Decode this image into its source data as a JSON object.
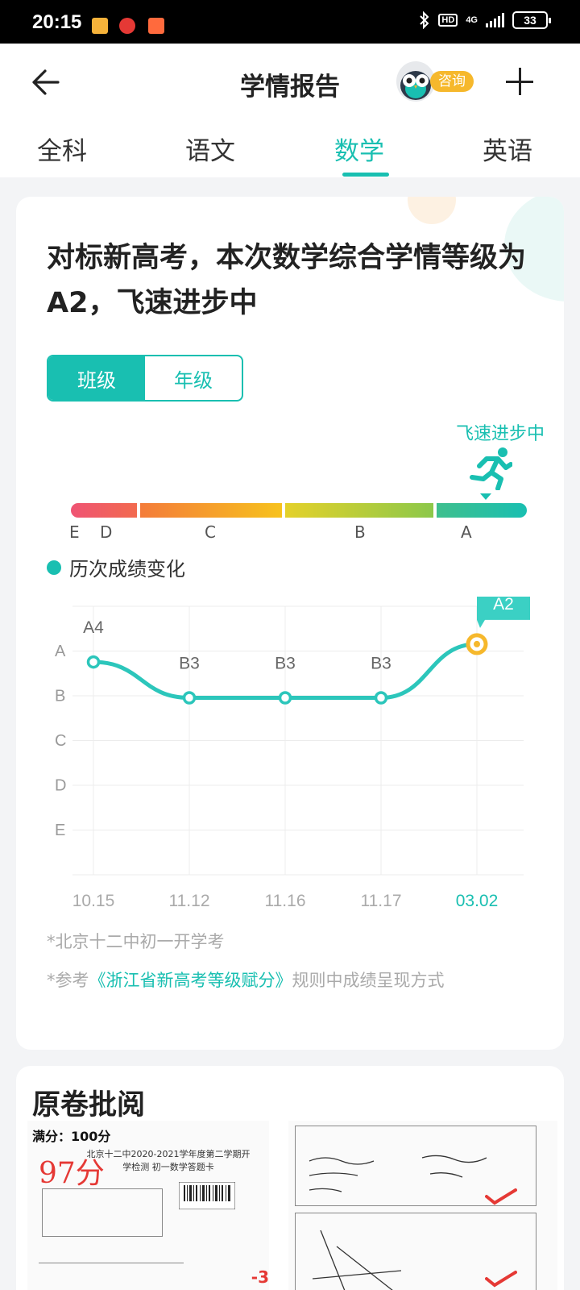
{
  "status_bar": {
    "time": "20:15",
    "hd": "HD",
    "network": "4G",
    "battery": "33"
  },
  "header": {
    "title": "学情报告",
    "consult_label": "咨询"
  },
  "tabs": [
    "全科",
    "语文",
    "数学",
    "英语"
  ],
  "active_tab": 2,
  "report": {
    "headline": "对标新高考，本次数学综合学情等级为A2，飞速进步中",
    "toggle": [
      "班级",
      "年级"
    ],
    "progress_label": "飞速进步中",
    "grade_scale": [
      "E",
      "D",
      "C",
      "B",
      "A"
    ],
    "current_grade_position": 0.91,
    "legend": "历次成绩变化",
    "notes": {
      "school": "*北京十二中初一开学考",
      "ref_prefix": "*参考",
      "ref_link": "《浙江省新高考等级赋分》",
      "ref_suffix": "规则中成绩呈现方式"
    }
  },
  "chart_data": {
    "type": "line",
    "x": [
      "10.15",
      "11.12",
      "11.16",
      "11.17",
      "03.02"
    ],
    "y_categories": [
      "A",
      "B",
      "C",
      "D",
      "E"
    ],
    "series": [
      {
        "values": [
          "A4",
          "B3",
          "B3",
          "B3",
          "A2"
        ]
      }
    ],
    "highlight_index": 4,
    "grid": true,
    "colors": {
      "line": "#2cc6bb",
      "highlight": "#f6b82c",
      "accent": "#19bfb1"
    }
  },
  "paper": {
    "title": "原卷批阅",
    "total_score": "满分：100分",
    "score": "97分",
    "exam_heading": "北京十二中2020-2021学年度第二学期开学检测 初一数学答题卡",
    "deduction": "-3"
  },
  "colors": {
    "brand": "#19bfb1",
    "orange": "#f6b82c"
  }
}
